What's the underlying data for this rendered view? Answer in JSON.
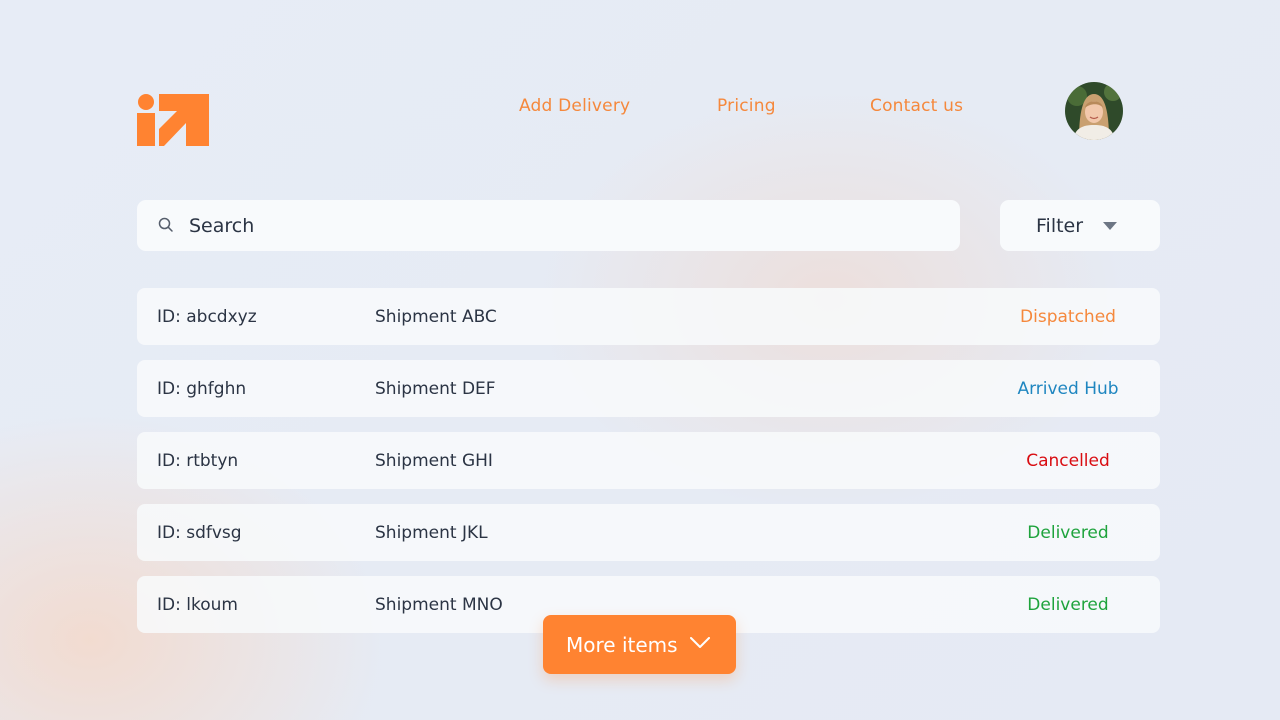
{
  "header": {
    "logo_icon": "brand-logo-icon",
    "nav": [
      {
        "label": "Add Delivery"
      },
      {
        "label": "Pricing"
      },
      {
        "label": "Contact us"
      }
    ],
    "avatar_icon": "user-avatar-icon"
  },
  "search": {
    "placeholder": "Search",
    "value": "",
    "icon": "search-icon"
  },
  "filter": {
    "label": "Filter",
    "icon": "caret-down-icon"
  },
  "shipments": [
    {
      "id": "ID: abcdxyz",
      "name": "Shipment ABC",
      "status": "Dispatched",
      "status_color": "#f5883c"
    },
    {
      "id": "ID: ghfghn",
      "name": "Shipment DEF",
      "status": "Arrived Hub",
      "status_color": "#1f86c0"
    },
    {
      "id": "ID: rtbtyn",
      "name": "Shipment GHI",
      "status": "Cancelled",
      "status_color": "#d90d12"
    },
    {
      "id": "ID: sdfvsg",
      "name": "Shipment JKL",
      "status": "Delivered",
      "status_color": "#1ea33c"
    },
    {
      "id": "ID: lkoum",
      "name": "Shipment MNO",
      "status": "Delivered",
      "status_color": "#1ea33c"
    }
  ],
  "more_button": {
    "label": "More items",
    "icon": "chevron-down-icon"
  },
  "colors": {
    "accent": "#ff8331",
    "surface": "#f8fafc",
    "text": "#2b3444"
  }
}
